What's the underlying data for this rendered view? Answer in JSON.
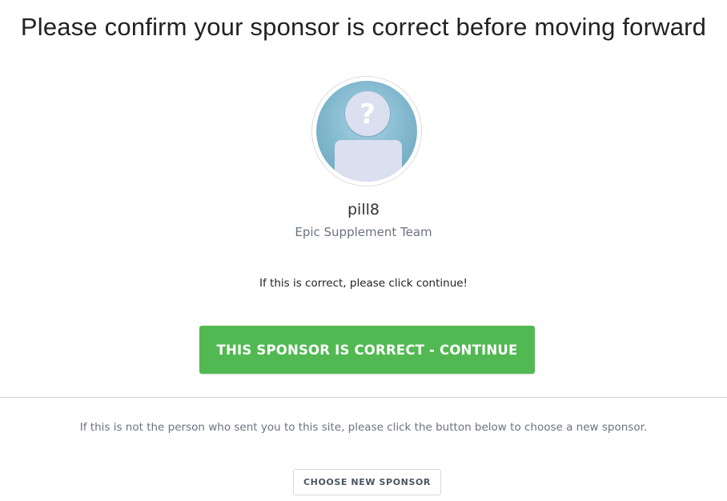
{
  "page": {
    "title": "Please confirm your sponsor is correct before moving forward"
  },
  "sponsor": {
    "avatar_icon": "unknown-user-avatar",
    "avatar_glyph": "?",
    "name": "pill8",
    "team": "Epic Supplement Team"
  },
  "confirm": {
    "prompt": "If this is correct, please click continue!",
    "button_label": "THIS SPONSOR IS CORRECT - CONTINUE",
    "button_color": "#52b952"
  },
  "change": {
    "prompt": "If this is not the person who sent you to this site, please click the button below to choose a new sponsor.",
    "button_label": "CHOOSE NEW SPONSOR"
  }
}
